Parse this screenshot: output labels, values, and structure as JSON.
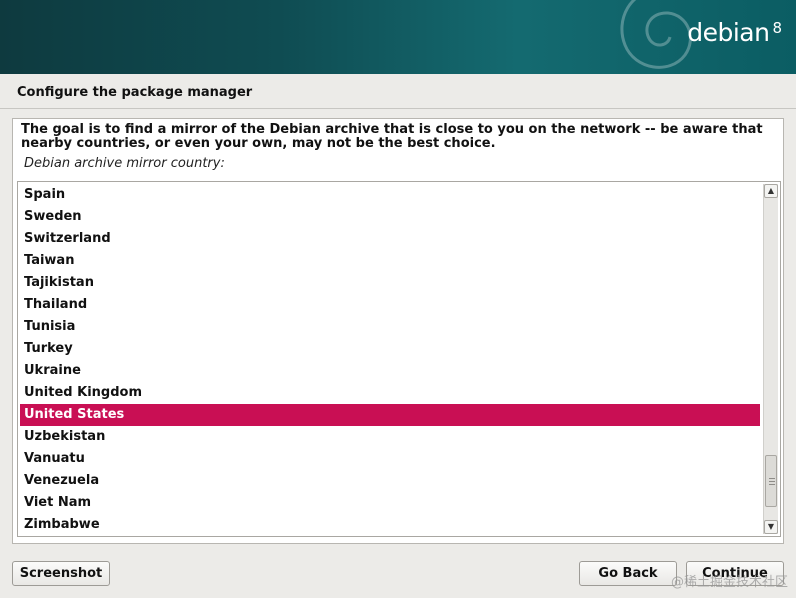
{
  "banner": {
    "brand_name": "debian",
    "brand_version": "8"
  },
  "page_title": "Configure the package manager",
  "description": "The goal is to find a mirror of the Debian archive that is close to you on the network -- be aware that nearby countries, or even your own, may not be the best choice.",
  "question": "Debian archive mirror country:",
  "countries": [
    "Spain",
    "Sweden",
    "Switzerland",
    "Taiwan",
    "Tajikistan",
    "Thailand",
    "Tunisia",
    "Turkey",
    "Ukraine",
    "United Kingdom",
    "United States",
    "Uzbekistan",
    "Vanuatu",
    "Venezuela",
    "Viet Nam",
    "Zimbabwe"
  ],
  "selected_country": "United States",
  "scrollbar": {
    "up_icon": "▲",
    "down_icon": "▼",
    "position_fraction": 0.96
  },
  "buttons": {
    "screenshot": "Screenshot",
    "go_back": "Go Back",
    "continue": "Continue"
  },
  "watermark": "@稀土掘金技术社区",
  "colors": {
    "selection": "#c90f54",
    "banner": "#0f4c52"
  }
}
